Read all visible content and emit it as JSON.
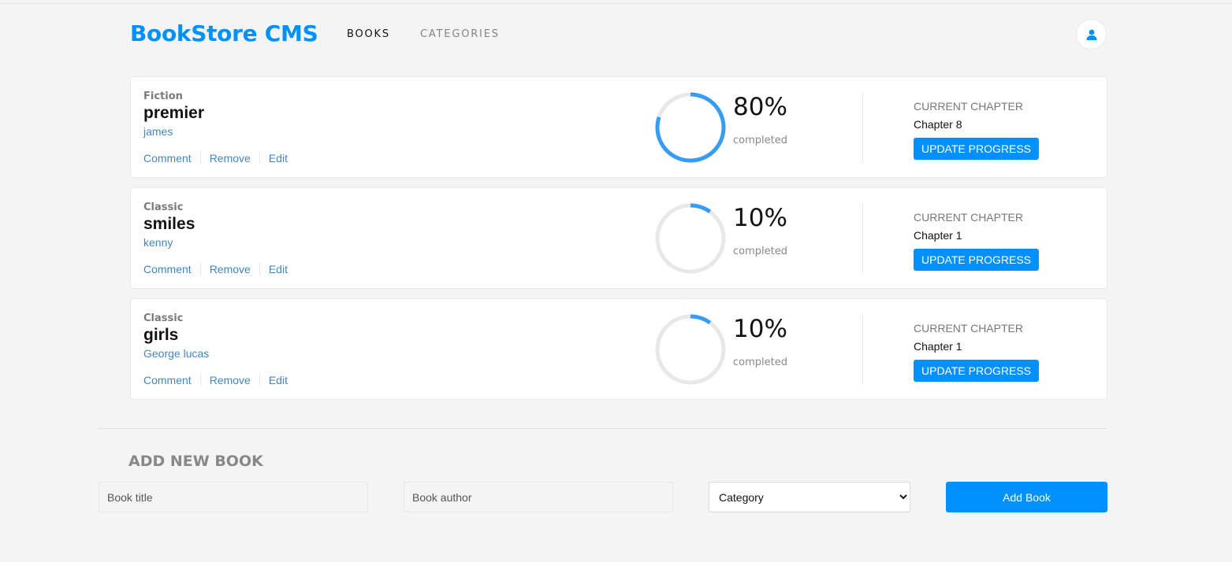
{
  "header": {
    "logo": "BookStore CMS",
    "nav": [
      {
        "label": "BOOKS"
      },
      {
        "label": "CATEGORIES"
      }
    ],
    "user_icon": "user-icon"
  },
  "books": [
    {
      "genre": "Fiction",
      "title": "premier",
      "author": "james",
      "actions": [
        "Comment",
        "Remove",
        "Edit"
      ],
      "progress": 0.8,
      "percent_label": "80%",
      "completed_label": "completed",
      "chapter_label": "CURRENT CHAPTER",
      "chapter": "Chapter 8",
      "update_label": "UPDATE PROGRESS"
    },
    {
      "genre": "Classic",
      "title": "smiles",
      "author": "kenny",
      "actions": [
        "Comment",
        "Remove",
        "Edit"
      ],
      "progress": 0.1,
      "percent_label": "10%",
      "completed_label": "completed",
      "chapter_label": "CURRENT CHAPTER",
      "chapter": "Chapter 1",
      "update_label": "UPDATE PROGRESS"
    },
    {
      "genre": "Classic",
      "title": "girls",
      "author": "George lucas",
      "actions": [
        "Comment",
        "Remove",
        "Edit"
      ],
      "progress": 0.1,
      "percent_label": "10%",
      "completed_label": "completed",
      "chapter_label": "CURRENT CHAPTER",
      "chapter": "Chapter 1",
      "update_label": "UPDATE PROGRESS"
    }
  ],
  "form": {
    "title": "ADD NEW BOOK",
    "title_placeholder": "Book title",
    "author_placeholder": "Book author",
    "category_selected": "Category",
    "add_label": "Add Book"
  },
  "colors": {
    "accent": "#0290ff",
    "link": "#4386bf",
    "progress": "#379cf6",
    "track": "#e8e8e8"
  }
}
